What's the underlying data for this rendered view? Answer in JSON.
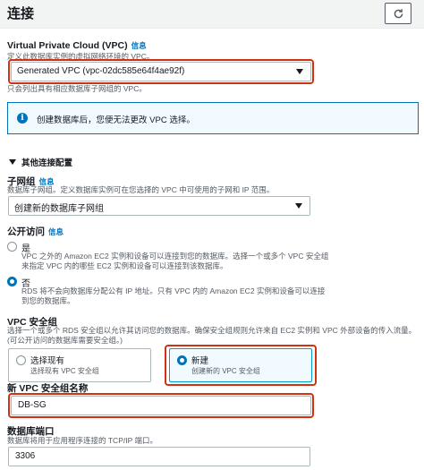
{
  "header": {
    "title": "连接"
  },
  "vpc": {
    "label": "Virtual Private Cloud (VPC)",
    "info": "信息",
    "description": "定义此数据库实例的虚拟网络环境的 VPC。",
    "selected": "Generated VPC (vpc-02dc585e64f4ae92f)",
    "hint": "只会列出具有相应数据库子网组的 VPC。"
  },
  "alert": {
    "text": "创建数据库后，您便无法更改 VPC 选择。"
  },
  "additional": {
    "label": "其他连接配置"
  },
  "subnet_group": {
    "label": "子网组",
    "info": "信息",
    "description": "数据库子网组。定义数据库实例可在您选择的 VPC 中可使用的子网和 IP 范围。",
    "selected": "创建新的数据库子网组"
  },
  "public_access": {
    "label": "公开访问",
    "info": "信息",
    "options": [
      {
        "label": "是",
        "description": "VPC 之外的 Amazon EC2 实例和设备可以连接到您的数据库。选择一个或多个 VPC 安全组来指定 VPC 内的哪些 EC2 实例和设备可以连接到该数据库。"
      },
      {
        "label": "否",
        "description": "RDS 将不会向数据库分配公有 IP 地址。只有 VPC 内的 Amazon EC2 实例和设备可以连接到您的数据库。"
      }
    ]
  },
  "security_group": {
    "label": "VPC 安全组",
    "description": "选择一个或多个 RDS 安全组以允许其访问您的数据库。确保安全组规则允许来自 EC2 实例和 VPC 外部设备的传入流量。(可公开访问的数据库需要安全组。)",
    "choose_existing": {
      "label": "选择现有",
      "description": "选择现有 VPC 安全组"
    },
    "create_new": {
      "label": "新建",
      "description": "创建新的 VPC 安全组"
    }
  },
  "new_sg_name": {
    "label": "新 VPC 安全组名称",
    "value": "DB-SG"
  },
  "port": {
    "label": "数据库端口",
    "description": "数据库将用于应用程序连接的 TCP/IP 端口。",
    "value": "3306"
  }
}
